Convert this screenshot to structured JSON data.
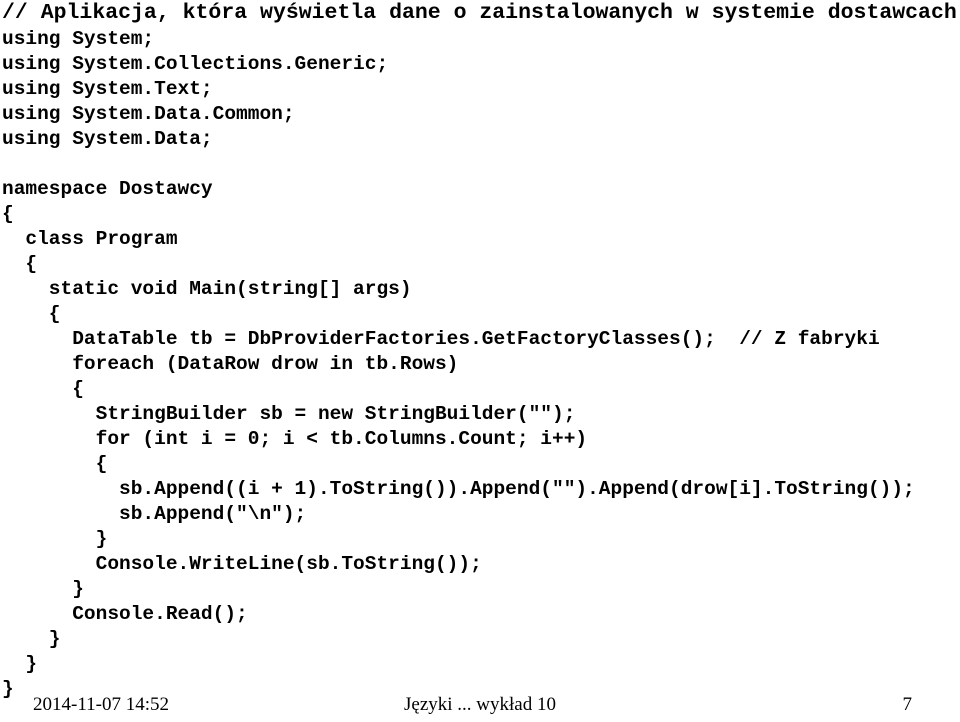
{
  "slide": {
    "language": "pl",
    "background_color": "#ffffff",
    "text_color": "#000000"
  },
  "code": {
    "title_comment": "// Aplikacja, która wyświetla dane o zainstalowanych w systemie dostawcach",
    "lines": [
      "using System;",
      "using System.Collections.Generic;",
      "using System.Text;",
      "using System.Data.Common;",
      "using System.Data;",
      "",
      "namespace Dostawcy",
      "{",
      "  class Program",
      "  {",
      "    static void Main(string[] args)",
      "    {",
      "      DataTable tb = DbProviderFactories.GetFactoryClasses();  // Z fabryki",
      "      foreach (DataRow drow in tb.Rows)",
      "      {",
      "        StringBuilder sb = new StringBuilder(\"\");",
      "        for (int i = 0; i < tb.Columns.Count; i++)",
      "        {",
      "          sb.Append((i + 1).ToString()).Append(\"\").Append(drow[i].ToString());",
      "          sb.Append(\"\\n\");",
      "        }",
      "        Console.WriteLine(sb.ToString());",
      "      }",
      "      Console.Read();",
      "    }",
      "  }",
      "}"
    ]
  },
  "footer": {
    "date": "2014-11-07 14:52",
    "center": "Języki ... wykład 10",
    "page_number": "7"
  }
}
